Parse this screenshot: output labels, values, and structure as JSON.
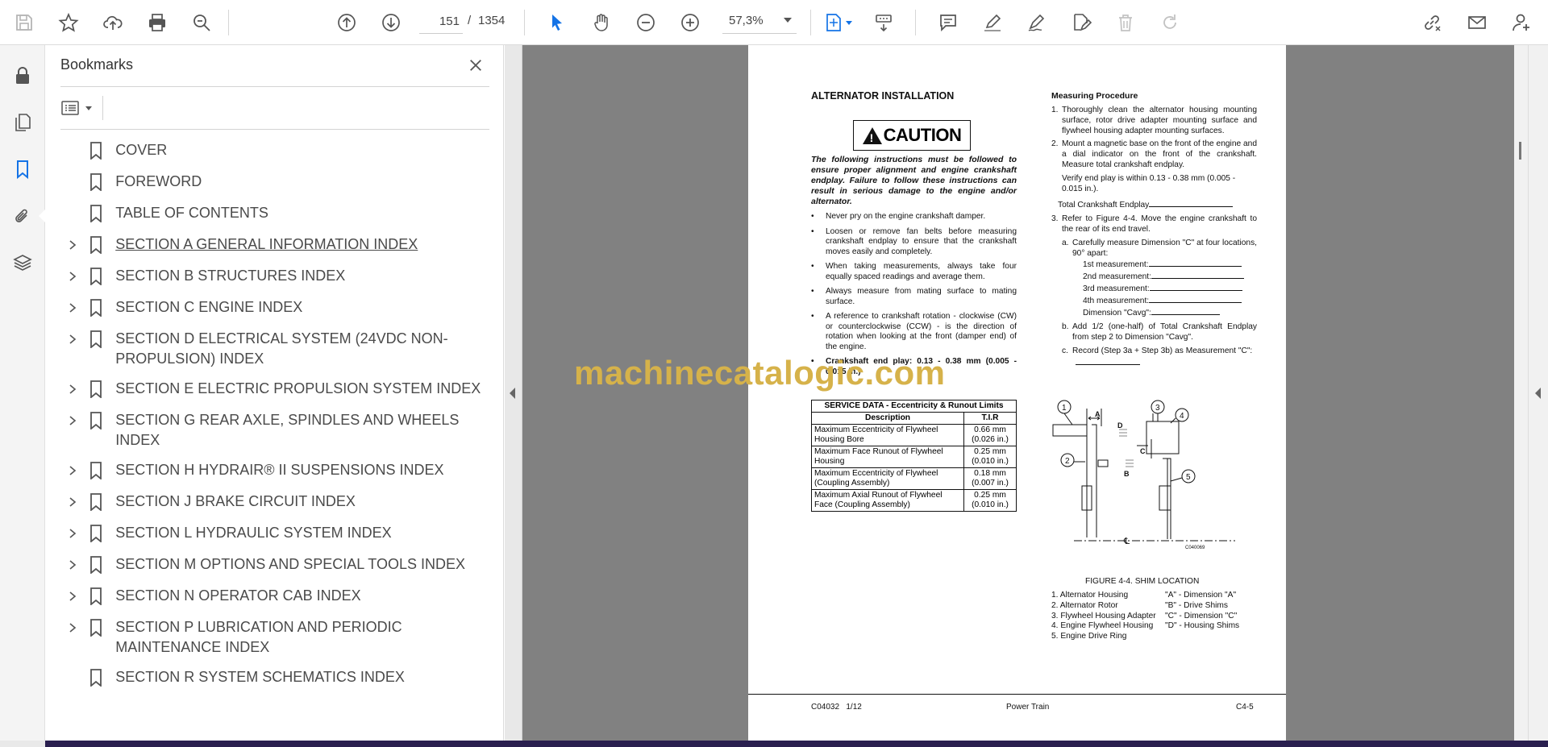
{
  "toolbar": {
    "current_page": "151",
    "page_separator": "/",
    "total_pages": "1354",
    "zoom": "57,3%"
  },
  "bookmarks": {
    "title": "Bookmarks",
    "items": [
      {
        "label": "COVER",
        "expandable": false
      },
      {
        "label": "FOREWORD",
        "expandable": false
      },
      {
        "label": "TABLE OF CONTENTS",
        "expandable": false
      },
      {
        "label": "SECTION A GENERAL INFORMATION INDEX",
        "expandable": true
      },
      {
        "label": "SECTION B STRUCTURES INDEX",
        "expandable": true
      },
      {
        "label": "SECTION C ENGINE INDEX",
        "expandable": true
      },
      {
        "label": "SECTION D ELECTRICAL SYSTEM (24VDC NON-PROPULSION) INDEX",
        "expandable": true
      },
      {
        "label": "SECTION E ELECTRIC PROPULSION SYSTEM INDEX",
        "expandable": true
      },
      {
        "label": "SECTION G REAR AXLE, SPINDLES AND WHEELS INDEX",
        "expandable": true
      },
      {
        "label": "SECTION H HYDRAIR® II SUSPENSIONS INDEX",
        "expandable": true
      },
      {
        "label": "SECTION J BRAKE CIRCUIT INDEX",
        "expandable": true
      },
      {
        "label": "SECTION L HYDRAULIC SYSTEM INDEX",
        "expandable": true
      },
      {
        "label": "SECTION M OPTIONS AND SPECIAL TOOLS INDEX",
        "expandable": true
      },
      {
        "label": "SECTION N OPERATOR CAB INDEX",
        "expandable": true
      },
      {
        "label": "SECTION P LUBRICATION AND PERIODIC MAINTENANCE INDEX",
        "expandable": true
      },
      {
        "label": "SECTION R SYSTEM SCHEMATICS INDEX",
        "expandable": false
      }
    ]
  },
  "document": {
    "heading": "ALTERNATOR INSTALLATION",
    "caution": "CAUTION",
    "intro": "The following instructions must be followed to ensure proper alignment and engine crankshaft endplay. Failure to follow these instructions can result in serious damage to the engine and/or alternator.",
    "bullets": [
      "Never pry on the engine crankshaft damper.",
      "Loosen or remove fan belts before measuring crankshaft endplay to ensure that the crankshaft moves easily and completely.",
      "When taking measurements, always take four equally spaced readings and average them.",
      "Always measure from mating surface to mating surface.",
      "A reference to crankshaft rotation - clockwise (CW) or counterclockwise (CCW) - is the direction of rotation when looking at the front (damper end) of the engine.",
      "Crankshaft end play: 0.13 - 0.38 mm (0.005 - 0.015 in.)"
    ],
    "table": {
      "title": "SERVICE DATA - Eccentricity & Runout Limits",
      "col_desc": "Description",
      "col_tir": "T.I.R",
      "rows": [
        {
          "desc": "Maximum Eccentricity of Flywheel Housing Bore",
          "val": "0.66 mm (0.026 in.)"
        },
        {
          "desc": "Maximum Face Runout of Flywheel Housing",
          "val": "0.25 mm (0.010 in.)"
        },
        {
          "desc": "Maximum Eccentricity of Flywheel (Coupling Assembly)",
          "val": "0.18 mm (0.007 in.)"
        },
        {
          "desc": "Maximum Axial Runout of Flywheel Face (Coupling Assembly)",
          "val": "0.25 mm (0.010 in.)"
        }
      ]
    },
    "right_heading": "Measuring Procedure",
    "step1": "Thoroughly clean the alternator housing mounting surface, rotor drive adapter mounting surface and flywheel housing adapter mounting surfaces.",
    "step2": "Mount a magnetic base on the front of the engine and a dial indicator on the front of the crankshaft. Measure total crankshaft endplay.",
    "verify": "Verify end play is within 0.13 - 0.38 mm (0.005 - 0.015 in.).",
    "total_endplay": "Total Crankshaft Endplay",
    "step3": "Refer to Figure 4-4. Move the engine crankshaft to the rear of its end travel.",
    "step3a": "Carefully measure Dimension \"C\" at four locations, 90° apart:",
    "meas": [
      "1st measurement:",
      "2nd measurement:",
      "3rd measurement:",
      "4th measurement:",
      "Dimension \"Cavg\":"
    ],
    "step3b": "Add 1/2 (one-half) of Total Crankshaft Endplay from step 2 to Dimension \"Cavg\".",
    "step3c": "Record (Step 3a + Step 3b) as Measurement \"C\":",
    "figure_caption": "FIGURE 4-4. SHIM LOCATION",
    "figure_code": "C040069",
    "legend_left": [
      "1. Alternator Housing",
      "2. Alternator Rotor",
      "3. Flywheel Housing Adapter",
      "4. Engine Flywheel Housing",
      "5. Engine Drive Ring"
    ],
    "legend_right": [
      "\"A\" - Dimension \"A\"",
      "\"B\" - Drive Shims",
      "\"C\" - Dimension \"C\"",
      "\"D\" - Housing Shims"
    ],
    "footer_left": "C04032   1/12",
    "footer_center": "Power Train",
    "footer_right": "C4-5"
  },
  "watermark": "machinecatalogic.com",
  "colors": {
    "accent": "#1473e6",
    "watermark": "#d6b24a",
    "viewer_bg": "#818181"
  }
}
